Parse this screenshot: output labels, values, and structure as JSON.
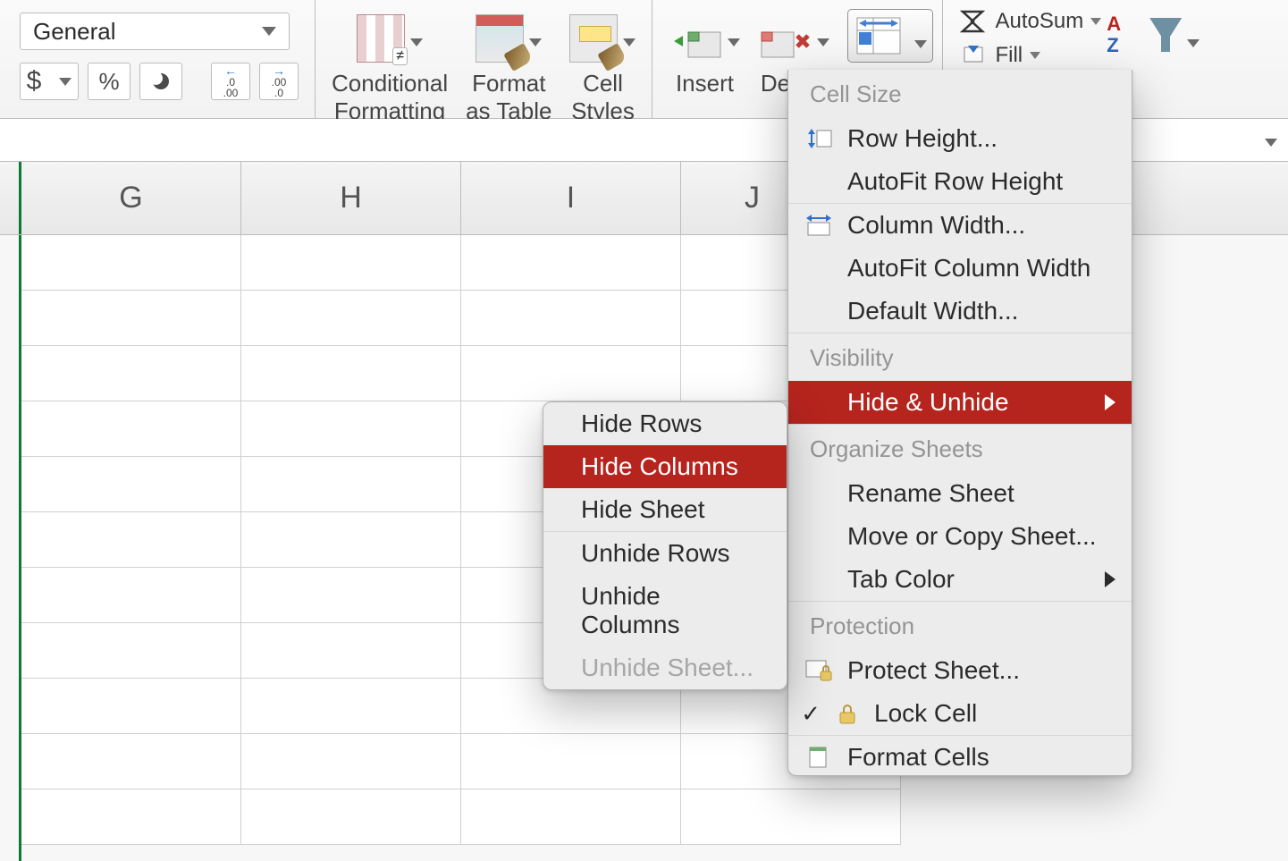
{
  "ribbon": {
    "number_format_selected": "General",
    "currency": "$",
    "percent": "%",
    "decrease_decimal_tip": ".0 .00",
    "increase_decimal_tip": ".00 .0",
    "conditional_formatting": "Conditional\nFormatting",
    "format_as_table": "Format\nas Table",
    "cell_styles": "Cell\nStyles",
    "insert": "Insert",
    "delete": "Delete",
    "autosum": "AutoSum",
    "fill": "Fill"
  },
  "columns": [
    "G",
    "H",
    "I",
    "J"
  ],
  "format_menu": {
    "sections": {
      "cell_size": "Cell Size",
      "visibility": "Visibility",
      "organize": "Organize Sheets",
      "protection": "Protection"
    },
    "row_height": "Row Height...",
    "autofit_row": "AutoFit Row Height",
    "col_width": "Column Width...",
    "autofit_col": "AutoFit Column Width",
    "default_width": "Default Width...",
    "hide_unhide": "Hide & Unhide",
    "rename_sheet": "Rename Sheet",
    "move_copy": "Move or Copy Sheet...",
    "tab_color": "Tab Color",
    "protect_sheet": "Protect Sheet...",
    "lock_cell": "Lock Cell",
    "format_cells": "Format Cells"
  },
  "hide_menu": {
    "hide_rows": "Hide Rows",
    "hide_columns": "Hide Columns",
    "hide_sheet": "Hide Sheet",
    "unhide_rows": "Unhide Rows",
    "unhide_columns": "Unhide Columns",
    "unhide_sheet": "Unhide Sheet..."
  }
}
